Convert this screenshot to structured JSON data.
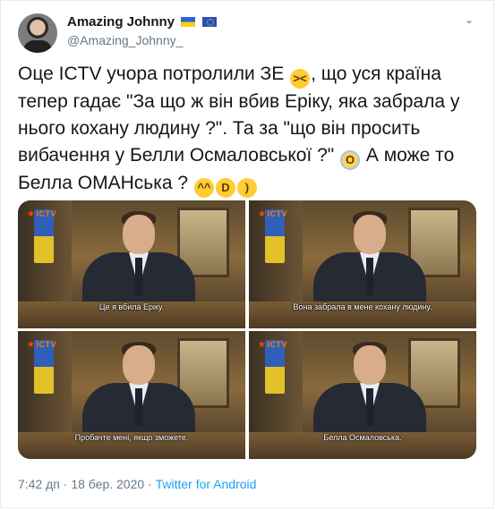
{
  "author": {
    "display_name": "Amazing Johnny",
    "handle": "@Amazing_Johnny_",
    "flags": [
      "ua-flag-icon",
      "eu-flag-icon"
    ]
  },
  "tweet": {
    "line1": "Оце ICTV учора потролили ЗЕ ",
    "line1b": ", що уся країна",
    "line2": "тепер гадає \"За що ж він вбив Еріку, яка забрала у",
    "line3": "нього кохану людину ?\". Та за \"що він просить",
    "line4": "вибачення у Белли Осмаловської ?\" ",
    "line4b": " А може то",
    "line5": "Белла ОМАНська ? ",
    "emojis": [
      "grinning-squinting-face-icon",
      "face-screaming-icon",
      "tears-of-joy-icon",
      "grinning-face-icon",
      "smiling-face-icon"
    ]
  },
  "media": {
    "channel_logo": "ICTV",
    "frames": [
      {
        "subtitle": "Це я вбила Еріку."
      },
      {
        "subtitle": "Вона забрала в мене кохану людину."
      },
      {
        "subtitle": "Пробачте мені, якщо зможете."
      },
      {
        "subtitle": "Белла Осмаловська."
      }
    ]
  },
  "meta": {
    "timestamp": "7:42 дп · 18 бер. 2020",
    "separator": " · ",
    "source": "Twitter for Android"
  },
  "colors": {
    "accent": "#1da1f2",
    "secondary_text": "#657786",
    "emoji": "#ffcc33"
  }
}
